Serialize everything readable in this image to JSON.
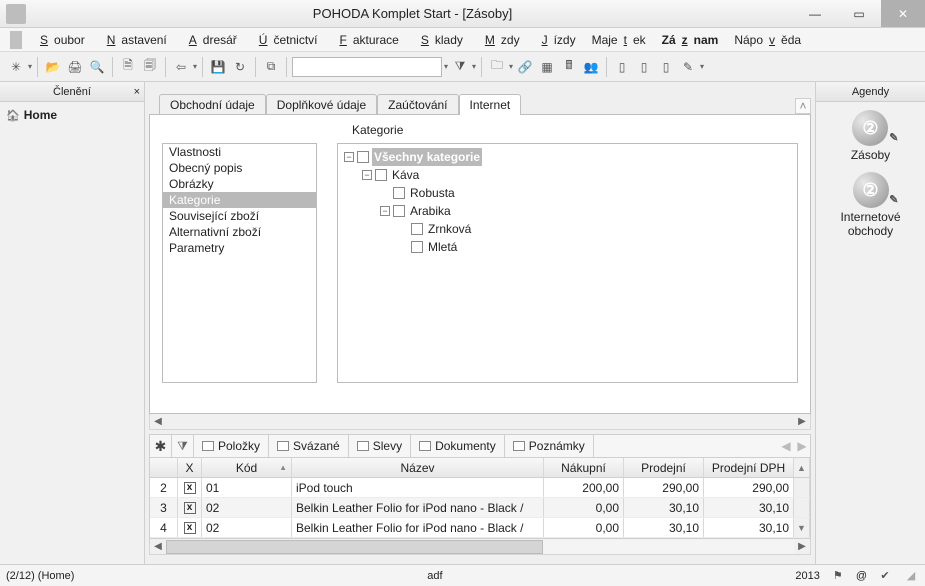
{
  "window": {
    "title": "POHODA Komplet Start - [Zásoby]"
  },
  "menu": {
    "items": [
      "Soubor",
      "Nastavení",
      "Adresář",
      "Účetnictví",
      "Fakturace",
      "Sklady",
      "Mzdy",
      "Jízdy",
      "Majetek",
      "Záznam",
      "Nápověda"
    ],
    "boldIndex": 9
  },
  "leftPanel": {
    "title": "Členění",
    "home": "Home"
  },
  "rightPanel": {
    "title": "Agendy",
    "items": [
      {
        "label": "Zásoby"
      },
      {
        "label": "Internetové obchody"
      }
    ]
  },
  "tabs": {
    "items": [
      "Obchodní údaje",
      "Doplňkové údaje",
      "Zaúčtování",
      "Internet"
    ],
    "activeIndex": 3
  },
  "internet": {
    "kategorieLabel": "Kategorie",
    "sideList": [
      "Vlastnosti",
      "Obecný popis",
      "Obrázky",
      "Kategorie",
      "Související zboží",
      "Alternativní zboží",
      "Parametry"
    ],
    "sideSelectedIndex": 3,
    "tree": {
      "root": "Všechny kategorie",
      "children": [
        {
          "label": "Káva",
          "children": [
            {
              "label": "Robusta"
            },
            {
              "label": "Arabika",
              "children": [
                {
                  "label": "Zrnková"
                },
                {
                  "label": "Mletá"
                }
              ]
            }
          ]
        }
      ]
    }
  },
  "subtabs": [
    "Položky",
    "Svázané",
    "Slevy",
    "Dokumenty",
    "Poznámky"
  ],
  "grid": {
    "headers": {
      "x": "X",
      "kod": "Kód",
      "nazev": "Název",
      "nakupni": "Nákupní",
      "prodejni": "Prodejní",
      "prodejnidph": "Prodejní DPH"
    },
    "rows": [
      {
        "n": "2",
        "x": true,
        "kod": "01",
        "nazev": "iPod touch",
        "nakupni": "200,00",
        "prodejni": "290,00",
        "prodejnidph": "290,00"
      },
      {
        "n": "3",
        "x": true,
        "kod": "02",
        "nazev": "Belkin Leather Folio for iPod nano - Black /",
        "nakupni": "0,00",
        "prodejni": "30,10",
        "prodejnidph": "30,10"
      },
      {
        "n": "4",
        "x": true,
        "kod": "02",
        "nazev": "Belkin Leather Folio for iPod nano - Black /",
        "nakupni": "0,00",
        "prodejni": "30,10",
        "prodejnidph": "30,10"
      }
    ]
  },
  "status": {
    "pos": "(2/12) (Home)",
    "mid": "adf",
    "year": "2013",
    "at": "@"
  }
}
